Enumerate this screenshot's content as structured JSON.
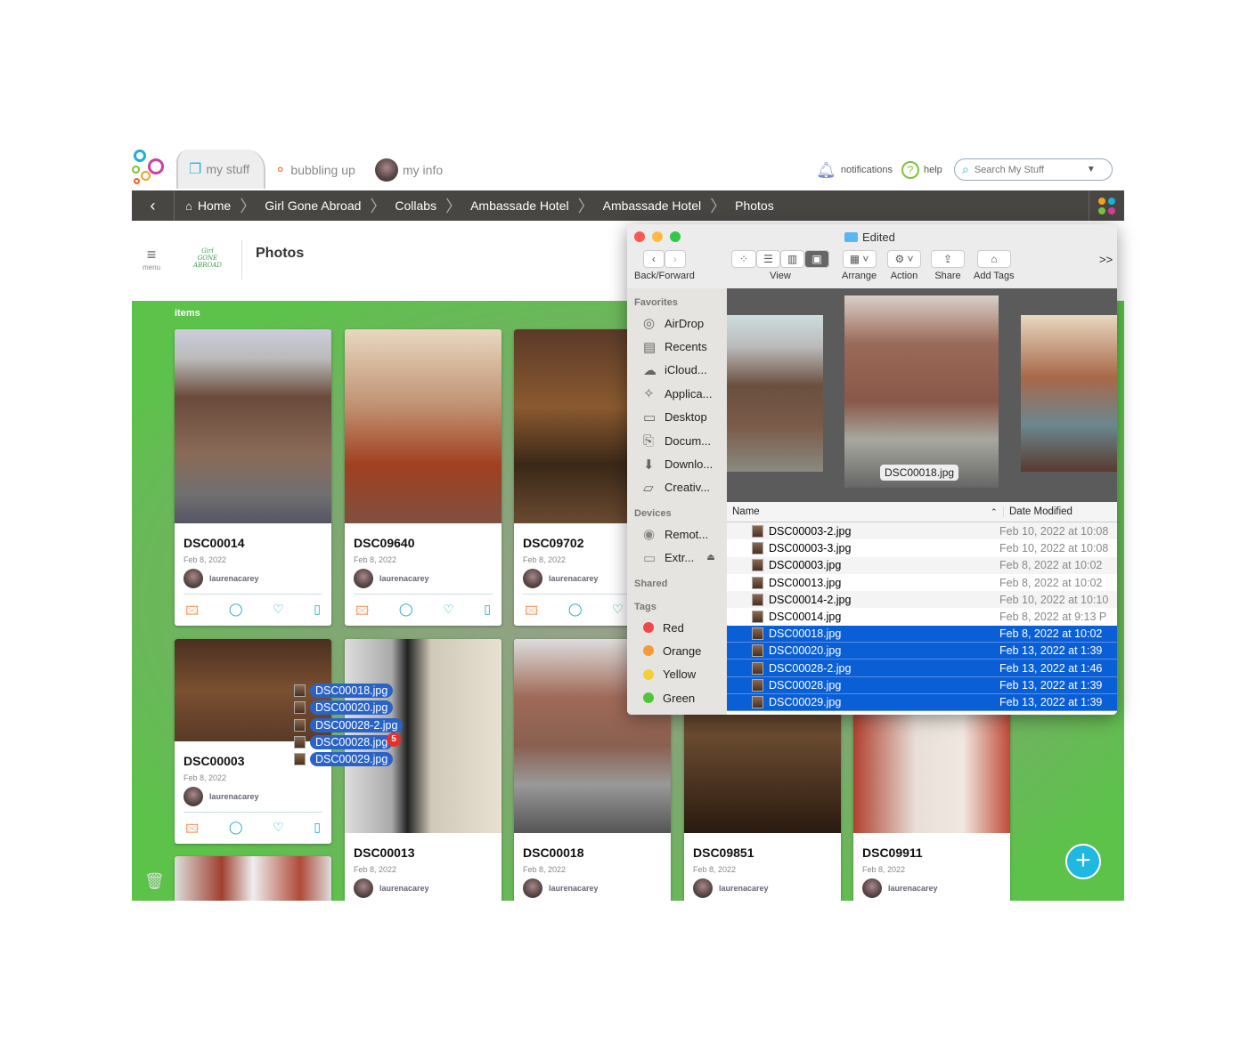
{
  "topbar": {
    "tabs": [
      {
        "label": "my stuff",
        "icon": "folders-icon"
      },
      {
        "label": "bubbling up",
        "icon": "bubbles-icon"
      },
      {
        "label": "my info",
        "icon": "avatar"
      }
    ],
    "notifications": "notifications",
    "help": "help",
    "search_placeholder": "Search My Stuff"
  },
  "breadcrumb": [
    "Home",
    "Girl Gone Abroad",
    "Collabs",
    "Ambassade Hotel",
    "Ambassade Hotel",
    "Photos"
  ],
  "header": {
    "menu": "menu",
    "title": "Photos",
    "logo_text": "Girl Gone Abroad"
  },
  "items_label": "items",
  "cards": [
    {
      "title": "DSC00014",
      "date": "Feb 8, 2022",
      "user": "laurenacarey"
    },
    {
      "title": "DSC09640",
      "date": "Feb 8, 2022",
      "user": "laurenacarey"
    },
    {
      "title": "DSC09702",
      "date": "Feb 8, 2022",
      "user": "laurenacarey"
    },
    {
      "title": "DSC00003",
      "date": "Feb 8, 2022",
      "user": "laurenacarey"
    },
    {
      "title": "DSC00013",
      "date": "Feb 8, 2022",
      "user": "laurenacarey"
    },
    {
      "title": "DSC00018",
      "date": "Feb 8, 2022",
      "user": "laurenacarey"
    },
    {
      "title": "DSC09851",
      "date": "Feb 8, 2022",
      "user": "laurenacarey"
    },
    {
      "title": "DSC09911",
      "date": "Feb 8, 2022",
      "user": "laurenacarey"
    }
  ],
  "drag": {
    "files": [
      "DSC00018.jpg",
      "DSC00020.jpg",
      "DSC00028-2.jpg",
      "DSC00028.jpg",
      "DSC00029.jpg"
    ],
    "count": "5"
  },
  "finder": {
    "title": "Edited",
    "toolbar": {
      "back_forward": "Back/Forward",
      "view": "View",
      "arrange": "Arrange",
      "action": "Action",
      "share": "Share",
      "add_tags": "Add Tags",
      "more": ">>"
    },
    "sidebar": {
      "favorites": "Favorites",
      "fav_items": [
        "AirDrop",
        "Recents",
        "iCloud...",
        "Applica...",
        "Desktop",
        "Docum...",
        "Downlo...",
        "Creativ..."
      ],
      "devices": "Devices",
      "dev_items": [
        "Remot...",
        "Extr..."
      ],
      "shared": "Shared",
      "tags": "Tags",
      "tag_items": [
        {
          "label": "Red",
          "color": "#f04848"
        },
        {
          "label": "Orange",
          "color": "#f59a38"
        },
        {
          "label": "Yellow",
          "color": "#f5cf36"
        },
        {
          "label": "Green",
          "color": "#52c43a"
        }
      ]
    },
    "preview_label": "DSC00018.jpg",
    "columns": {
      "name": "Name",
      "date": "Date Modified"
    },
    "files": [
      {
        "name": "DSC00003-2.jpg",
        "date": "Feb 10, 2022 at 10:08",
        "selected": false
      },
      {
        "name": "DSC00003-3.jpg",
        "date": "Feb 10, 2022 at 10:08",
        "selected": false
      },
      {
        "name": "DSC00003.jpg",
        "date": "Feb 8, 2022 at 10:02",
        "selected": false
      },
      {
        "name": "DSC00013.jpg",
        "date": "Feb 8, 2022 at 10:02",
        "selected": false
      },
      {
        "name": "DSC00014-2.jpg",
        "date": "Feb 10, 2022 at 10:10",
        "selected": false
      },
      {
        "name": "DSC00014.jpg",
        "date": "Feb 8, 2022 at 9:13 P",
        "selected": false
      },
      {
        "name": "DSC00018.jpg",
        "date": "Feb 8, 2022 at 10:02",
        "selected": true
      },
      {
        "name": "DSC00020.jpg",
        "date": "Feb 13, 2022 at 1:39",
        "selected": true
      },
      {
        "name": "DSC00028-2.jpg",
        "date": "Feb 13, 2022 at 1:46",
        "selected": true
      },
      {
        "name": "DSC00028.jpg",
        "date": "Feb 13, 2022 at 1:39",
        "selected": true
      },
      {
        "name": "DSC00029.jpg",
        "date": "Feb 13, 2022 at 1:39",
        "selected": true
      }
    ]
  },
  "colors": {
    "selection": "#0a5fd6",
    "breadcrumb_bg": "#484643",
    "accent": "#2ab0d0",
    "fab": "#1fb8e0"
  }
}
